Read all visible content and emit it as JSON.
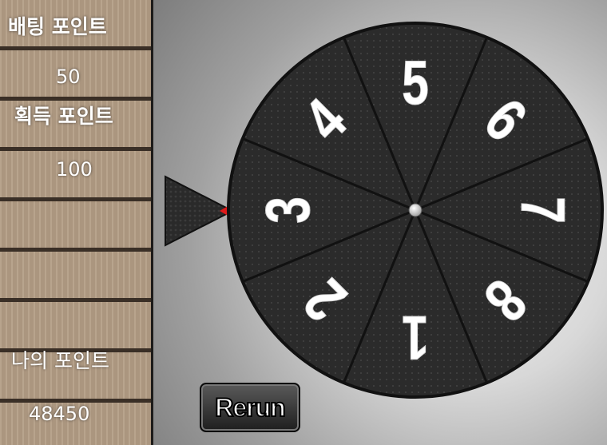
{
  "sidebar": {
    "bet_label": "배팅 포인트",
    "bet_value": "50",
    "win_label": "획득 포인트",
    "win_value": "100",
    "my_label": "나의 포인트",
    "my_value": "48450"
  },
  "wheel": {
    "numbers": [
      "5",
      "6",
      "7",
      "8",
      "1",
      "2",
      "3",
      "4"
    ],
    "colors": {
      "segment": "#2b2b2b",
      "divider": "#111111",
      "text": "#ffffff",
      "marker": "#e01919"
    }
  },
  "buttons": {
    "rerun_label": "Rerun"
  }
}
